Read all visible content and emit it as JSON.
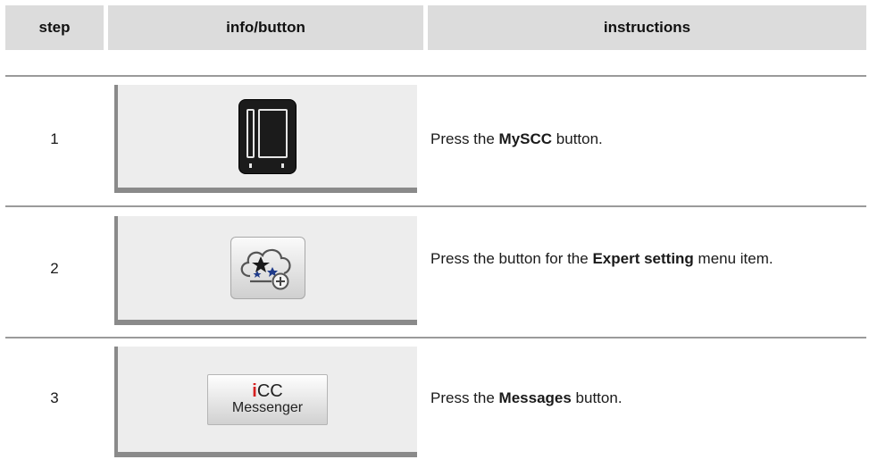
{
  "header": {
    "step": "step",
    "info": "info/button",
    "instructions": "instructions"
  },
  "steps": [
    {
      "number": "1",
      "button_icon": "myscc-oven-icon",
      "instruction_pre": "Press the ",
      "instruction_bold": "MySCC",
      "instruction_post": " button."
    },
    {
      "number": "2",
      "button_icon": "expert-setting-icon",
      "instruction_pre": "Press the button for the ",
      "instruction_bold": "Expert setting",
      "instruction_post": " menu item."
    },
    {
      "number": "3",
      "button_icon": "icc-messenger-icon",
      "button_text_top_i": "i",
      "button_text_top_rest": "CC",
      "button_text_bottom": "Messenger",
      "instruction_pre": "Press the ",
      "instruction_bold": "Messages",
      "instruction_post": " button."
    }
  ],
  "colors": {
    "header_bg": "#dcdcdc",
    "panel_bg": "#ededed",
    "separator": "#9a9a9a",
    "icc_red": "#d51f1f"
  }
}
